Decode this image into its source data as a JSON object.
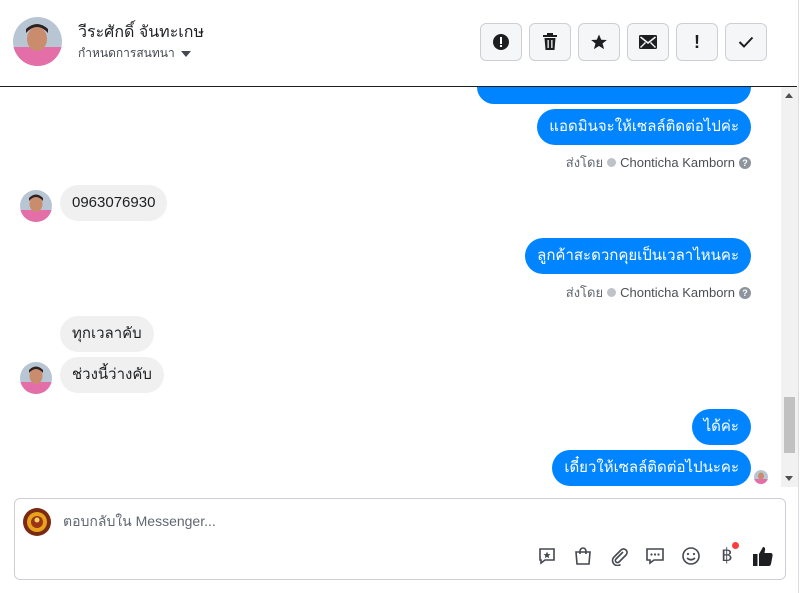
{
  "header": {
    "contact_name": "วีระศักดิ์ จันทะเกษ",
    "assign_label": "กำหนดการสนทนา"
  },
  "toolbar": {
    "buttons": [
      {
        "icon": "alert-circle-icon"
      },
      {
        "icon": "trash-icon"
      },
      {
        "icon": "star-icon"
      },
      {
        "icon": "envelope-icon"
      },
      {
        "icon": "exclamation-icon",
        "label": "!"
      },
      {
        "icon": "check-icon"
      }
    ]
  },
  "thread": {
    "messages": [
      {
        "from": "page",
        "text": "แอดมินจะให้เซลล์ติดต่อไปค่ะ"
      },
      {
        "from": "page",
        "sent_by_label": "ส่งโดย",
        "agent": "Chonticha Kamborn"
      },
      {
        "from": "customer",
        "text": "0963076930"
      },
      {
        "from": "page",
        "text": "ลูกค้าสะดวกคุยเป็นเวลาไหนคะ"
      },
      {
        "from": "page",
        "sent_by_label": "ส่งโดย",
        "agent": "Chonticha Kamborn"
      },
      {
        "from": "customer",
        "text": "ทุกเวลาคับ"
      },
      {
        "from": "customer",
        "text": "ช่วงนี้ว่างคับ"
      },
      {
        "from": "page",
        "text": "ได้ค่ะ"
      },
      {
        "from": "page",
        "text": "เดี๋ยวให้เซลล์ติดต่อไปนะคะ"
      }
    ]
  },
  "composer": {
    "placeholder": "ตอบกลับใน Messenger...",
    "tools": [
      "saved-reply-icon",
      "shopping-bag-icon",
      "paperclip-icon",
      "chat-bubbles-icon",
      "smiley-icon",
      "baht-icon",
      "thumbs-up-icon"
    ],
    "baht_symbol": "฿"
  },
  "colors": {
    "outgoing_bubble": "#0084ff",
    "incoming_bubble": "#f0f0f0",
    "notification_dot": "#fa3e3e"
  }
}
